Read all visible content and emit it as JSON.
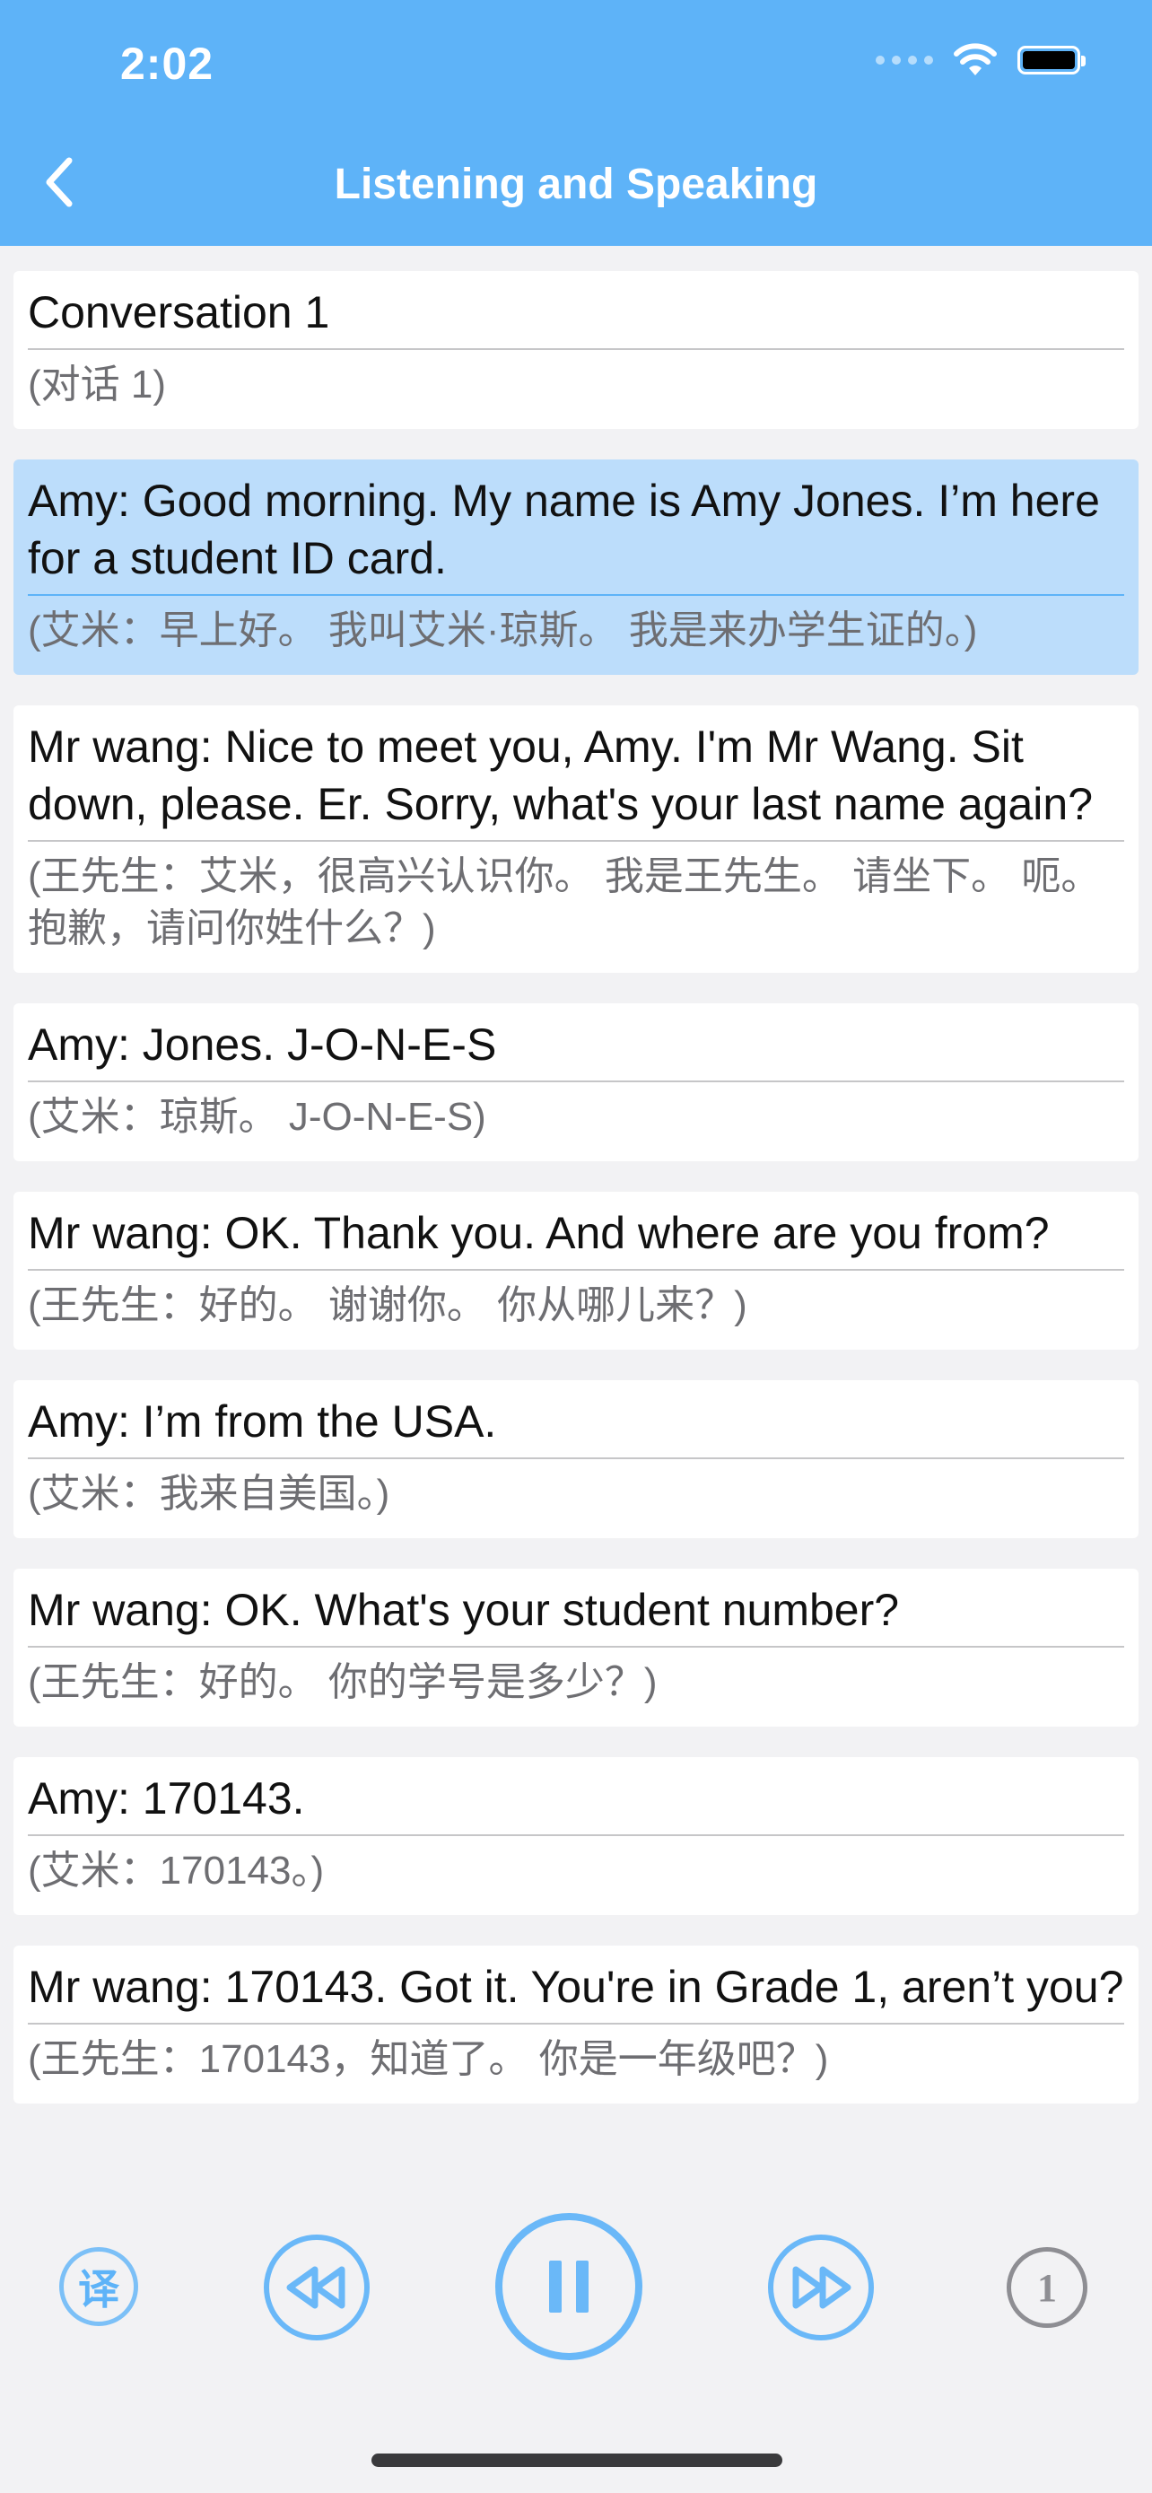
{
  "status_bar": {
    "time": "2:02"
  },
  "nav": {
    "title": "Listening and Speaking"
  },
  "conversation": [
    {
      "en": "Conversation 1",
      "zh": "(对话 1)",
      "active": false
    },
    {
      "en": "Amy: Good morning. My name is Amy Jones. I’m here for a student ID card.",
      "zh": "(艾米：早上好。 我叫艾米·琼斯。 我是来办学生证的。)",
      "active": true
    },
    {
      "en": "Mr wang: Nice to meet you, Amy. I'm Mr Wang. Sit down, please. Er. Sorry, what's your last name again?",
      "zh": "(王先生：艾米，很高兴认识你。 我是王先生。 请坐下。 呃。 抱歉，请问你姓什么？)",
      "active": false
    },
    {
      "en": "Amy: Jones. J-O-N-E-S",
      "zh": "(艾米：琼斯。 J-O-N-E-S)",
      "active": false
    },
    {
      "en": "Mr wang: OK. Thank you. And where are you from?",
      "zh": "(王先生：好的。 谢谢你。 你从哪儿来？)",
      "active": false
    },
    {
      "en": "Amy: I’m from the USA.",
      "zh": "(艾米：我来自美国。)",
      "active": false
    },
    {
      "en": "Mr wang: OK. What's your student number?",
      "zh": "(王先生：好的。 你的学号是多少？)",
      "active": false
    },
    {
      "en": "Amy: 170143.",
      "zh": "(艾米：170143。)",
      "active": false
    },
    {
      "en": "Mr wang: 170143. Got it. You're in Grade 1, aren’t you?",
      "zh": "(王先生：170143，知道了。 你是一年级吧？)",
      "active": false
    }
  ],
  "controls": {
    "translate_label": "译",
    "speed_label": "1",
    "rewind_icon": "rewind-icon",
    "pause_icon": "pause-icon",
    "forward_icon": "fast-forward-icon"
  },
  "colors": {
    "header": "#5eb3f8",
    "accent": "#6ab8f8",
    "active_card": "#bcddfb"
  }
}
